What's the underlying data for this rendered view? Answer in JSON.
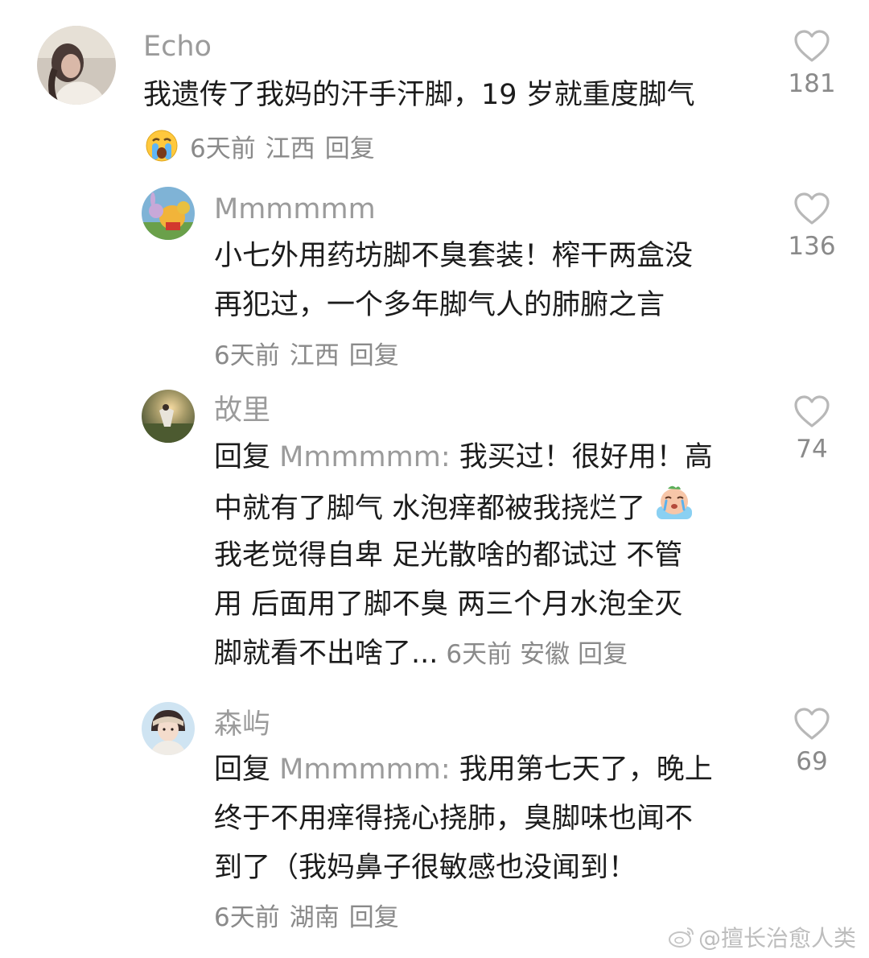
{
  "comments": [
    {
      "username": "Echo",
      "lines": [
        "我遗传了我妈的汗手汗脚，19 岁就重度脚气"
      ],
      "emoji": "crying-face",
      "time": "6天前",
      "location": "江西",
      "reply_label": "回复",
      "likes": "181"
    },
    {
      "username": "Mmmmmm",
      "lines": [
        "小七外用药坊脚不臭套装！榨干两盒没",
        "再犯过，一个多年脚气人的肺腑之言"
      ],
      "time": "6天前",
      "location": "江西",
      "reply_label": "回复",
      "likes": "136"
    },
    {
      "username": "故里",
      "reply_prefix": "回复",
      "reply_to": "Mmmmmm:",
      "lines": [
        "我买过！很好用！高",
        "中就有了脚气 水泡痒都被我挠烂了",
        "我老觉得自卑 足光散啥的都试过 不管",
        "用 后面用了脚不臭 两三个月水泡全灭",
        "脚就看不出啥了..."
      ],
      "emoji": "crying-bear",
      "time": "6天前",
      "location": "安徽",
      "reply_label": "回复",
      "likes": "74"
    },
    {
      "username": "森屿",
      "reply_prefix": "回复",
      "reply_to": "Mmmmmm:",
      "lines": [
        "我用第七天了，晚上",
        "终于不用痒得挠心挠肺，臭脚味也闻不",
        "到了（我妈鼻子很敏感也没闻到！"
      ],
      "time": "6天前",
      "location": "湖南",
      "reply_label": "回复",
      "likes": "69"
    }
  ],
  "watermark": "@擅长治愈人类",
  "colors": {
    "text": "#1c1c1c",
    "muted": "#9b9b9b",
    "meta": "#8a8a8a",
    "heart": "#b8b8b8"
  }
}
